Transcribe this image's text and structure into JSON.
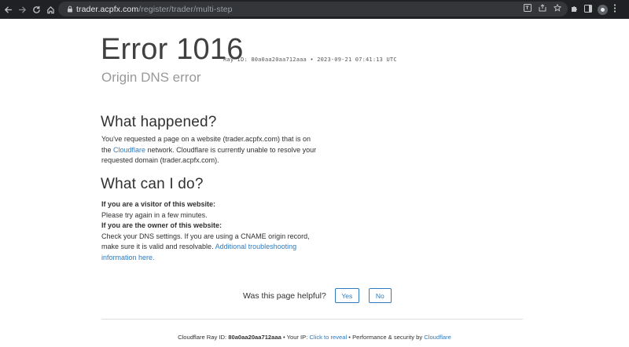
{
  "browser": {
    "url_host": "trader.acpfx.com",
    "url_path": "/register/trader/multi-step"
  },
  "error": {
    "title": "Error 1016",
    "ray_id": "Ray ID: 80a0aa20aa712aaa",
    "separator": "•",
    "timestamp": "2023-09-21 07:41:13 UTC",
    "subtitle": "Origin DNS error"
  },
  "what_happened": {
    "heading": "What happened?",
    "text_1": "You've requested a page on a website (trader.acpfx.com) that is on the",
    "link": "Cloudflare",
    "text_2": "network. Cloudflare is currently unable to resolve your requested domain (trader.acpfx.com)."
  },
  "what_can_i_do": {
    "heading": "What can I do?",
    "visitor_label": "If you are a visitor of this website:",
    "visitor_text": "Please try again in a few minutes.",
    "owner_label": "If you are the owner of this website:",
    "owner_text": "Check your DNS settings. If you are using a CNAME origin record, make sure it is valid and resolvable.",
    "owner_link": "Additional troubleshooting information here."
  },
  "feedback": {
    "question": "Was this page helpful?",
    "yes_label": "Yes",
    "no_label": "No"
  },
  "footer": {
    "ray_prefix": "Cloudflare Ray ID:",
    "ray_value": "80a0aa20aa712aaa",
    "sep": "•",
    "ip_prefix": "Your IP:",
    "ip_link": "Click to reveal",
    "perf_text": "Performance & security by",
    "cf_link": "Cloudflare"
  }
}
